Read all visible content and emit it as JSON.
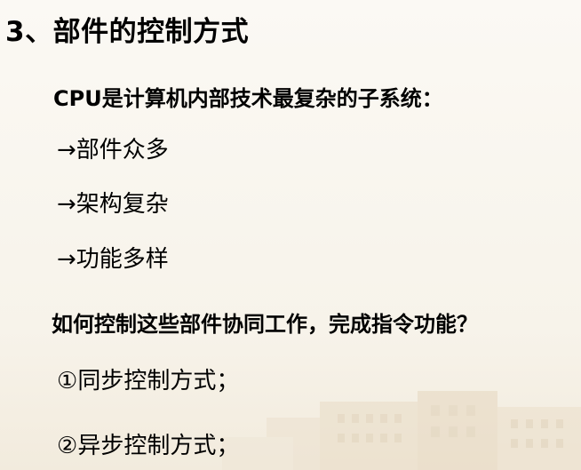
{
  "slide": {
    "title": "3、部件的控制方式",
    "intro": "CPU是计算机内部技术最复杂的子系统：",
    "features": [
      {
        "marker": "→",
        "text": "部件众多"
      },
      {
        "marker": "→",
        "text": "架构复杂"
      },
      {
        "marker": "→",
        "text": "功能多样"
      }
    ],
    "question": "如何控制这些部件协同工作，完成指令功能？",
    "modes": [
      {
        "marker": "①",
        "text": "同步控制方式；"
      },
      {
        "marker": "②",
        "text": "异步控制方式；"
      }
    ]
  },
  "colors": {
    "top_strip": "#5b78a8",
    "background": "#fbf9f4",
    "text": "#000000"
  }
}
